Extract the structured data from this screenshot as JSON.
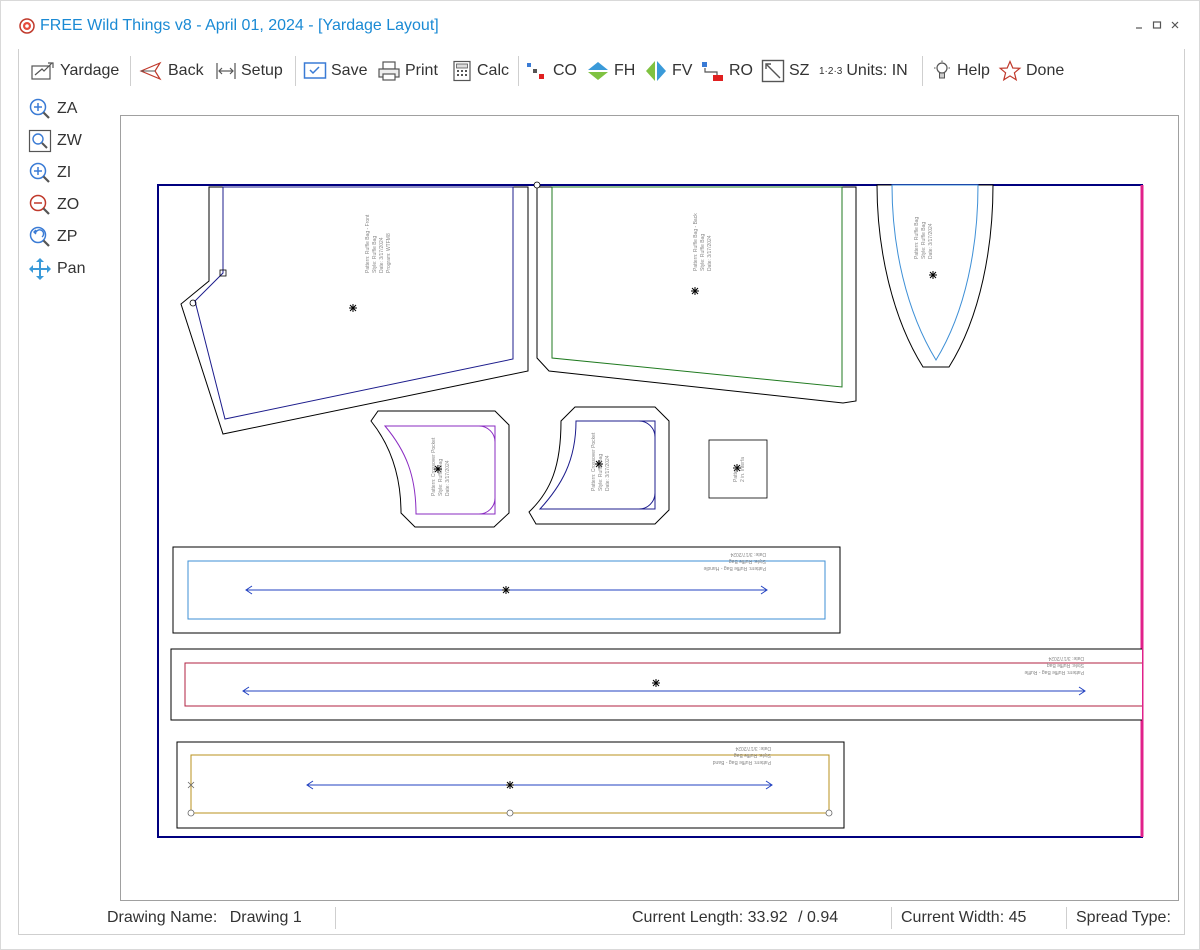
{
  "window": {
    "title": "FREE Wild Things v8 - April 01, 2024 - [Yardage Layout]",
    "controls": [
      "minimize-icon",
      "maximize-icon",
      "close-icon"
    ]
  },
  "toolbar": {
    "yardage": "Yardage",
    "back": "Back",
    "setup": "Setup",
    "save": "Save",
    "print": "Print",
    "calc": "Calc",
    "co": "CO",
    "fh": "FH",
    "fv": "FV",
    "ro": "RO",
    "sz": "SZ",
    "units_prefix": "1·2·3",
    "units": "Units: IN",
    "help": "Help",
    "done": "Done"
  },
  "sidebar": {
    "za": "ZA",
    "zw": "ZW",
    "zi": "ZI",
    "zo": "ZO",
    "zp": "ZP",
    "pan": "Pan"
  },
  "status": {
    "drawing_name_label": "Drawing Name:",
    "drawing_name": "Drawing 1",
    "current_length_label": "Current Length:",
    "current_length": "33.92",
    "current_length_extra": "/ 0.94",
    "current_width_label": "Current Width:",
    "current_width": "45",
    "spread_type_label": "Spread Type:"
  },
  "pieces": {
    "front": [
      "Pattern: Ruffle Bag - Front",
      "Style: Ruffle Bag",
      "Date: 3/17/2024",
      "Program: WTFM8"
    ],
    "back": [
      "Pattern: Ruffle Bag - Back",
      "Style: Ruffle Bag",
      "Date: 3/17/2024"
    ],
    "side": [
      "Pattern: Ruffle Bag",
      "Style: Ruffle Bag",
      "Date: 3/17/2024"
    ],
    "pocket_a": [
      "Pattern: Crossover Pocket",
      "Style: Ruffle Bag",
      "Date: 3/17/2024"
    ],
    "pocket_b": [
      "Pattern: Crossover Pocket",
      "Style: Ruffle Bag",
      "Date: 3/17/2024"
    ],
    "square": [
      "Pattern",
      "2 in. Interfa"
    ],
    "handle": [
      "Pattern: Ruffle Bag - Handle",
      "Style: Ruffle Bag",
      "Date: 3/17/2024"
    ],
    "ruffle": [
      "Pattern: Ruffle Bag - Ruffle",
      "Style: Ruffle Bag",
      "Date: 3/17/2024"
    ],
    "band": [
      "Pattern: Ruffle Bag - Band",
      "Style: Ruffle Bag",
      "Date: 3/17/2024"
    ]
  },
  "colors": {
    "title": "#1a8ad4",
    "marker_border": "#00007f",
    "marker_right_edge": "#e0218a",
    "front_sewline": "#1c1c8c",
    "back_sewline": "#1f7a1f",
    "side_sewline": "#3d8fd6",
    "pocket_a_sewline": "#8a2bc2",
    "pocket_b_sewline": "#1c1c8c",
    "handle_sewline": "#3d8fd6",
    "ruffle_sewline": "#b02040",
    "band_sewline": "#b8901c",
    "grainline": "#2040c0"
  }
}
